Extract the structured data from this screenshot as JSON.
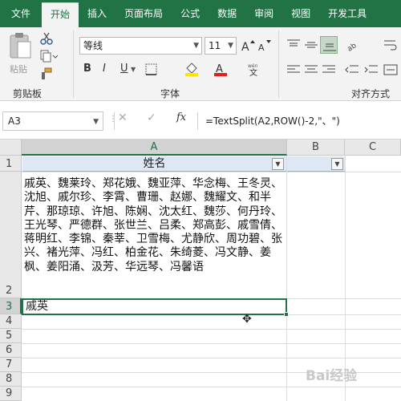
{
  "tabs": [
    "文件",
    "开始",
    "插入",
    "页面布局",
    "公式",
    "数据",
    "审阅",
    "视图",
    "开发工具"
  ],
  "ribbon": {
    "clipboard": {
      "paste_label": "粘贴",
      "group_label": "剪贴板"
    },
    "font": {
      "name": "等线",
      "size": "11",
      "bold": "B",
      "italic": "I",
      "underline": "U",
      "group_label": "字体",
      "font_color": "#e02020",
      "fill_color": "#ffe600"
    },
    "alignment": {
      "group_label": "对齐方式"
    }
  },
  "formula_bar": {
    "name_box": "A3",
    "cancel": "✕",
    "enter": "✓",
    "fx": "fx",
    "formula": "=TextSplit(A2,ROW()-2,\"、\")"
  },
  "grid": {
    "columns": [
      "A",
      "B",
      "C"
    ],
    "rows": [
      "1",
      "2",
      "3",
      "4",
      "5",
      "6",
      "7",
      "8",
      "9"
    ],
    "a1": "姓名",
    "a2": "戚英、魏莱玲、郑花娥、魏亚萍、华念梅、王冬灵、沈旭、戚尔珍、李霄、曹珊、赵娜、魏耀文、和半芹、那琼琼、许旭、陈娴、沈太红、魏莎、何丹玲、王光琴、严德群、张世兰、吕柔、郑高彭、戚雪倩、蒋明红、李锦、秦莘、卫雪梅、尤静欣、周功碧、张兴、褚光萍、冯红、柏金花、朱绮菱、冯文静、姜枫、姜阳涌、汲芳、华远琴、冯馨语",
    "a3": "戚英"
  },
  "watermark": "Bai经验",
  "accent": "#217346"
}
